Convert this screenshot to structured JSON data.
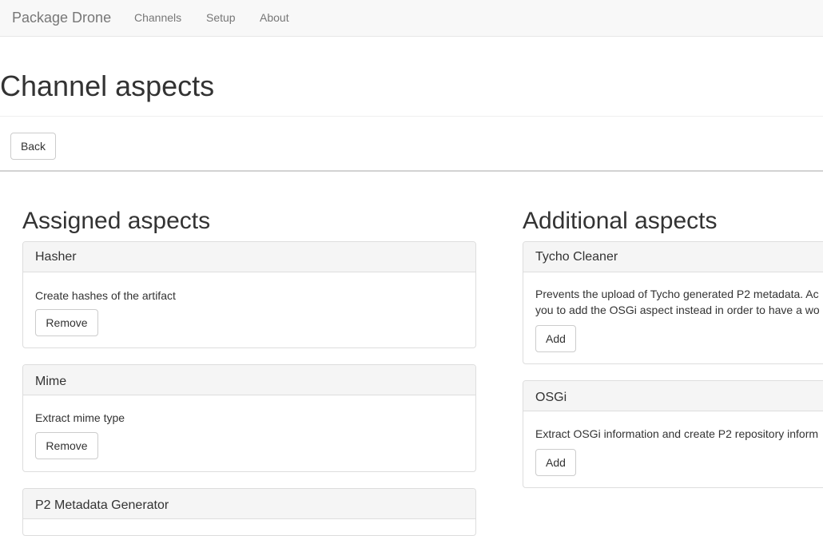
{
  "navbar": {
    "brand": "Package Drone",
    "links": [
      "Channels",
      "Setup",
      "About"
    ]
  },
  "page": {
    "title": "Channel aspects",
    "back_label": "Back"
  },
  "assigned": {
    "heading": "Assigned aspects",
    "panels": [
      {
        "title": "Hasher",
        "description": "Create hashes of the artifact",
        "button": "Remove"
      },
      {
        "title": "Mime",
        "description": "Extract mime type",
        "button": "Remove"
      },
      {
        "title": "P2 Metadata Generator"
      }
    ]
  },
  "additional": {
    "heading": "Additional aspects",
    "panels": [
      {
        "title": "Tycho Cleaner",
        "description_lines": [
          "Prevents the upload of Tycho generated P2 metadata. Ac",
          "you to add the OSGi aspect instead in order to have a wo"
        ],
        "button": "Add"
      },
      {
        "title": "OSGi",
        "description": "Extract OSGi information and create P2 repository inform",
        "button": "Add"
      }
    ]
  },
  "colors": {
    "navbar_bg": "#f8f8f8",
    "panel_heading_bg": "#f5f5f5",
    "border": "#dddddd",
    "text": "#333333",
    "nav_text": "#777777"
  }
}
